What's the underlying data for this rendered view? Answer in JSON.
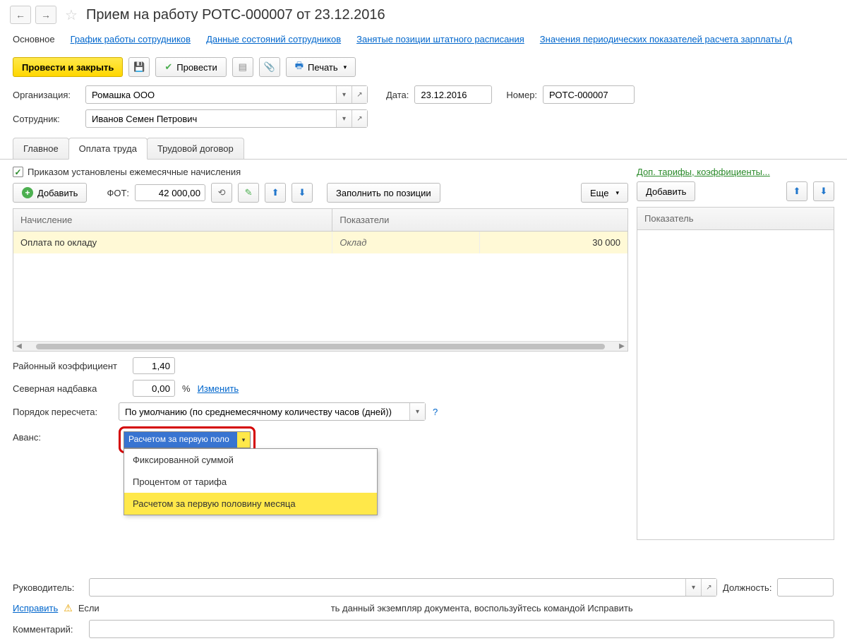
{
  "header": {
    "title": "Прием на работу РОТС-000007 от 23.12.2016"
  },
  "nav": {
    "main": "Основное",
    "schedule": "График работы сотрудников",
    "states": "Данные состояний сотрудников",
    "positions": "Занятые позиции штатного расписания",
    "values": "Значения периодических показателей расчета зарплаты (д"
  },
  "toolbar": {
    "post_close": "Провести и закрыть",
    "post": "Провести",
    "print": "Печать"
  },
  "form": {
    "org_label": "Организация:",
    "org_value": "Ромашка ООО",
    "date_label": "Дата:",
    "date_value": "23.12.2016",
    "number_label": "Номер:",
    "number_value": "РОТС-000007",
    "employee_label": "Сотрудник:",
    "employee_value": "Иванов Семен Петрович"
  },
  "tabs": {
    "main": "Главное",
    "payment": "Оплата труда",
    "contract": "Трудовой договор"
  },
  "payment": {
    "checkbox_label": "Приказом установлены ежемесячные начисления",
    "add": "Добавить",
    "fot_label": "ФОТ:",
    "fot_value": "42 000,00",
    "fill_by_position": "Заполнить по позиции",
    "more": "Еще",
    "extra_link": "Доп. тарифы, коэффициенты...",
    "add2": "Добавить",
    "col_accrual": "Начисление",
    "col_indicators": "Показатели",
    "col_indicator": "Показатель",
    "row_accrual": "Оплата по окладу",
    "row_indicator": "Оклад",
    "row_value": "30 000",
    "district_label": "Районный коэффициент",
    "district_value": "1,40",
    "north_label": "Северная надбавка",
    "north_value": "0,00",
    "percent": "%",
    "change": "Изменить",
    "recalc_label": "Порядок пересчета:",
    "recalc_value": "По умолчанию (по среднемесячному количеству часов (дней))",
    "advance_label": "Аванс:",
    "advance_selected": "Расчетом за первую поло",
    "advance_options": {
      "fixed": "Фиксированной суммой",
      "percent": "Процентом от тарифа",
      "calc": "Расчетом за первую половину месяца"
    }
  },
  "footer": {
    "manager_label": "Руководитель:",
    "position_label": "Должность:",
    "fix_link": "Исправить",
    "fix_text": "Если",
    "fix_text2": "ть данный экземпляр документа, воспользуйтесь командой Исправить",
    "comment_label": "Комментарий:"
  }
}
